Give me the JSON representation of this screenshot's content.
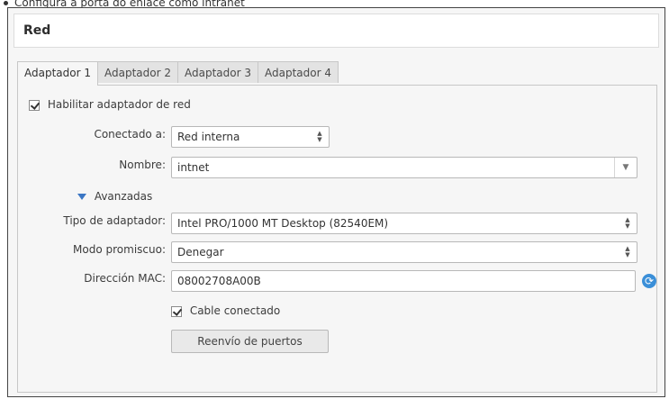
{
  "caption": "Configura a porta do enlace como intranet",
  "section_title": "Red",
  "tabs": [
    {
      "label": "Adaptador 1"
    },
    {
      "label": "Adaptador 2"
    },
    {
      "label": "Adaptador 3"
    },
    {
      "label": "Adaptador 4"
    }
  ],
  "enable_adapter": {
    "label": "Habilitar adaptador de red",
    "checked": true
  },
  "attached_to": {
    "label": "Conectado a:",
    "value": "Red interna"
  },
  "name": {
    "label": "Nombre:",
    "value": "intnet"
  },
  "advanced": {
    "label": "Avanzadas"
  },
  "adapter_type": {
    "label": "Tipo de adaptador:",
    "value": "Intel PRO/1000 MT Desktop (82540EM)"
  },
  "promiscuous": {
    "label": "Modo promiscuo:",
    "value": "Denegar"
  },
  "mac": {
    "label": "Dirección MAC:",
    "value": "08002708A00B"
  },
  "cable": {
    "label": "Cable conectado",
    "checked": true
  },
  "port_forwarding": {
    "label": "Reenvío de puertos"
  },
  "icons": {
    "refresh": "refresh-icon",
    "spin": "spin-arrows-icon",
    "dropdown": "chevron-down-icon",
    "advanced": "triangle-down-icon"
  },
  "colors": {
    "accent": "#3b8fd8",
    "panel_bg": "#f6f6f6"
  }
}
